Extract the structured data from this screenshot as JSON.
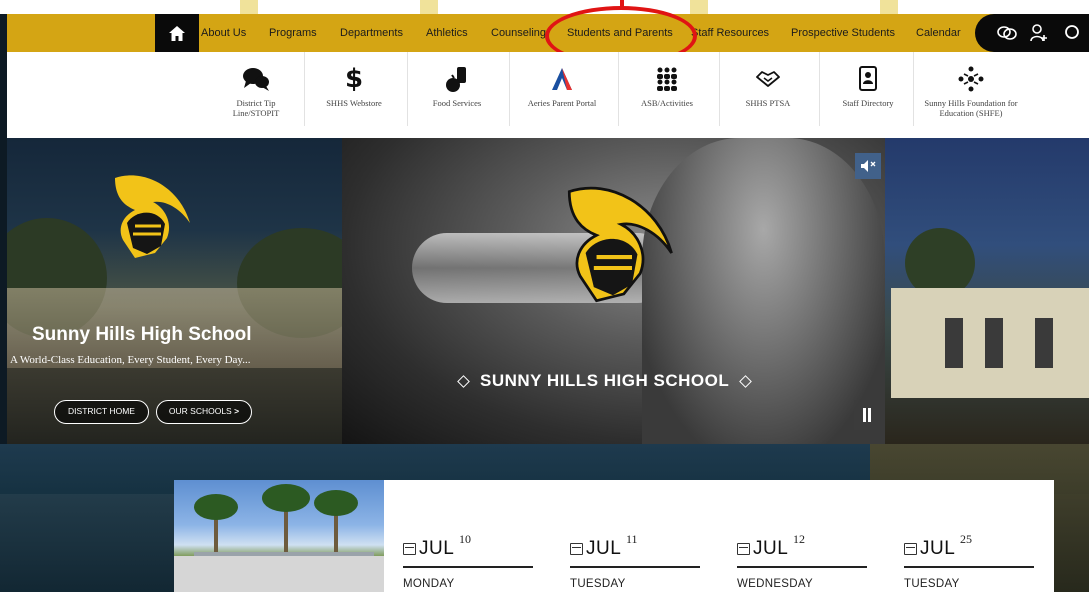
{
  "nav": {
    "items": [
      "About Us",
      "Programs",
      "Departments",
      "Athletics",
      "Counseling",
      "Students and Parents",
      "Staff Resources",
      "Prospective Students",
      "Calendar"
    ],
    "highlighted": "Students and Parents",
    "colors": {
      "bar": "#d4a514",
      "dark": "#0a0a0a",
      "highlight": "#e01414"
    }
  },
  "quicklinks": [
    {
      "label": "District Tip Line/STOPIT",
      "icon": "chat-bubbles-icon"
    },
    {
      "label": "SHHS Webstore",
      "icon": "dollar-icon"
    },
    {
      "label": "Food Services",
      "icon": "food-icon"
    },
    {
      "label": "Aeries Parent Portal",
      "icon": "aeries-logo-icon"
    },
    {
      "label": "ASB/Activities",
      "icon": "group-icon"
    },
    {
      "label": "SHHS PTSA",
      "icon": "handshake-icon"
    },
    {
      "label": "Staff Directory",
      "icon": "contact-book-icon"
    },
    {
      "label": "Sunny Hills Foundation for Education (SHFE)",
      "icon": "network-icon"
    }
  ],
  "hero": {
    "title": "Sunny Hills High School",
    "subtitle": "A World-Class Education, Every Student, Every Day...",
    "buttons": [
      "DISTRICT HOME",
      "OUR SCHOOLS"
    ],
    "slide_caption": "SUNNY HILLS HIGH SCHOOL"
  },
  "events": [
    {
      "month": "JUL",
      "day": "10",
      "weekday": "MONDAY"
    },
    {
      "month": "JUL",
      "day": "11",
      "weekday": "TUESDAY"
    },
    {
      "month": "JUL",
      "day": "12",
      "weekday": "WEDNESDAY"
    },
    {
      "month": "JUL",
      "day": "25",
      "weekday": "TUESDAY"
    }
  ]
}
